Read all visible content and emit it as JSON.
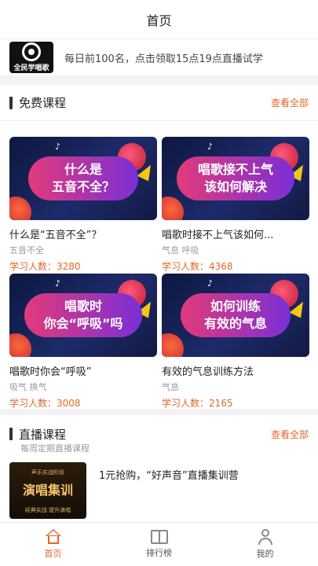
{
  "header": {
    "title": "首页"
  },
  "banner": {
    "logo_text": "全民学唱歌",
    "text": "每日前100名，点击领取15点19点直播试学"
  },
  "free_courses": {
    "title": "免费课程",
    "more": "查看全部",
    "items": [
      {
        "thumb_lines": [
          "什么是",
          "五音不全？"
        ],
        "title": "什么是“五音不全”？",
        "tags": "五音不全",
        "count": "学习人数：3280"
      },
      {
        "thumb_lines": [
          "唱歌接不上气",
          "该如何解决"
        ],
        "title": "唱歌时接不上气该如何...",
        "tags": "气息  呼吸",
        "count": "学习人数：4368"
      },
      {
        "thumb_lines": [
          "唱歌时",
          "你会“呼吸”吗"
        ],
        "title": "唱歌时你会“呼吸”",
        "tags": "吸气  换气",
        "count": "学习人数：3008"
      },
      {
        "thumb_lines": [
          "如何训练",
          "有效的气息"
        ],
        "title": "有效的气息训练方法",
        "tags": "气息",
        "count": "学习人数：2165"
      }
    ]
  },
  "live_courses": {
    "title": "直播课程",
    "subtitle": "每周定期直播课程",
    "more": "查看全部",
    "items": [
      {
        "thumb_small": "声乐实战阶段",
        "thumb_big": "演唱集训",
        "thumb_foot": "经典实战 提升演唱",
        "title": "1元抢购，“好声音”直播集训营"
      }
    ]
  },
  "tabbar": {
    "items": [
      {
        "label": "首页",
        "icon": "home-icon",
        "active": true
      },
      {
        "label": "排行榜",
        "icon": "book-icon",
        "active": false
      },
      {
        "label": "我的",
        "icon": "user-icon",
        "active": false
      }
    ]
  },
  "colors": {
    "accent": "#e0682a",
    "thumb_bg": "#1d2b6a",
    "pill_start": "#e23a7a",
    "pill_end": "#7a2fd6"
  }
}
